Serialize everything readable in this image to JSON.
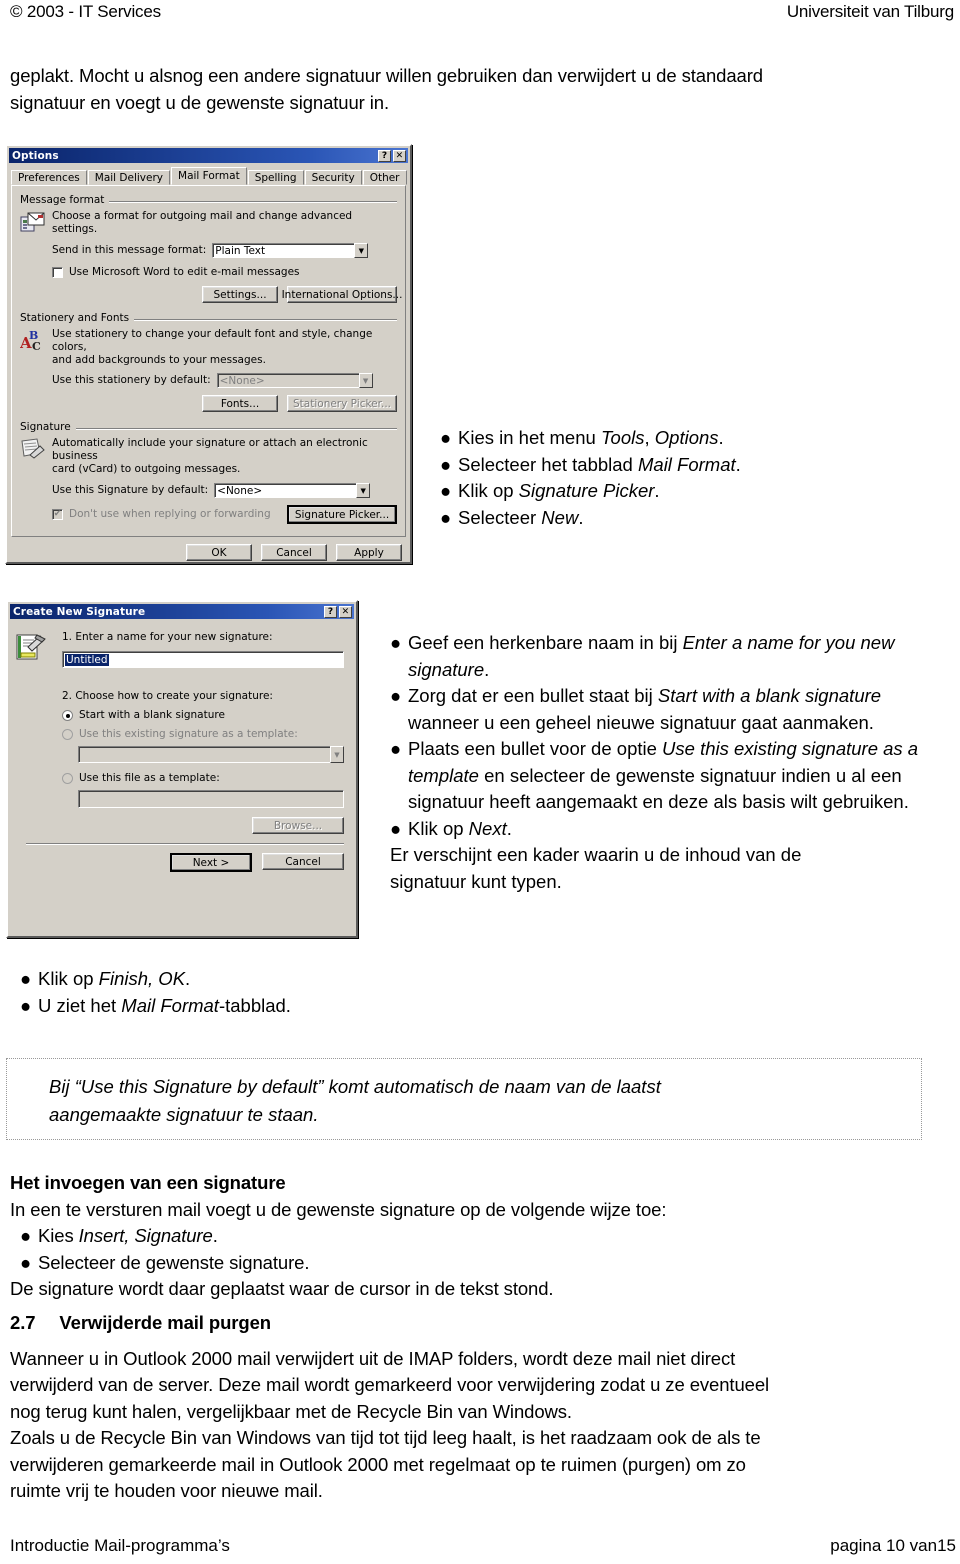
{
  "header": {
    "left": "© 2003 - IT Services",
    "right": "Universiteit van Tilburg"
  },
  "intro": {
    "line1": "geplakt. Mocht u alsnog een andere signatuur willen gebruiken dan verwijdert u de standaard",
    "line2": "signatuur en voegt u de gewenste signatuur in."
  },
  "options_dialog": {
    "title": "Options",
    "help_btn": "?",
    "close_btn": "✕",
    "tabs": [
      {
        "label": "Preferences",
        "active": false
      },
      {
        "label": "Mail Delivery",
        "active": false
      },
      {
        "label": "Mail Format",
        "active": true
      },
      {
        "label": "Spelling",
        "active": false
      },
      {
        "label": "Security",
        "active": false
      },
      {
        "label": "Other",
        "active": false
      }
    ],
    "message_format": {
      "group_label": "Message format",
      "description": "Choose a format for outgoing mail and change advanced settings.",
      "send_label": "Send in this message format:",
      "send_value": "Plain Text",
      "word_checkbox_label": "Use Microsoft Word to edit e-mail messages",
      "word_checkbox_checked": false,
      "settings_btn": "Settings...",
      "international_btn": "International Options..."
    },
    "stationery": {
      "group_label": "Stationery and Fonts",
      "description_line1": "Use stationery to change your default font and style, change colors,",
      "description_line2": "and add backgrounds to your messages.",
      "use_label": "Use this stationery by default:",
      "use_value": "<None>",
      "fonts_btn": "Fonts...",
      "picker_btn": "Stationery Picker..."
    },
    "signature": {
      "group_label": "Signature",
      "description_line1": "Automatically include your signature or attach an electronic business",
      "description_line2": "card (vCard) to outgoing messages.",
      "use_label": "Use this Signature by default:",
      "use_value": "<None>",
      "dont_use_label": "Don't use when replying or forwarding",
      "dont_use_checked": true,
      "picker_btn": "Signature Picker..."
    },
    "buttons": {
      "ok": "OK",
      "cancel": "Cancel",
      "apply": "Apply"
    }
  },
  "options_bullets": [
    {
      "pre": "Kies in het menu ",
      "em": "Tools",
      "mid": ", ",
      "em2": "Options",
      "post": "."
    },
    {
      "pre": "Selecteer het tabblad ",
      "em": "Mail Format",
      "post": "."
    },
    {
      "pre": "Klik op ",
      "em": "Signature Picker",
      "post": "."
    },
    {
      "pre": "Selecteer ",
      "em": "New",
      "post": "."
    }
  ],
  "signature_dialog": {
    "title": "Create New Signature",
    "help_btn": "?",
    "close_btn": "✕",
    "step1_label": "1. Enter a name for your new signature:",
    "name_value": "Untitled",
    "step2_label": "2. Choose how to create your signature:",
    "radio_blank": "Start with a blank signature",
    "radio_existing": "Use this existing signature as a template:",
    "radio_file": "Use this file as a template:",
    "existing_value": "",
    "file_value": "",
    "browse_btn": "Browse...",
    "next_btn": "Next >",
    "cancel_btn": "Cancel",
    "selected_option": "blank"
  },
  "signature_bullets_html": [
    "Geef een herkenbare naam in bij <i>Enter a name for you new signature</i>.",
    "Zorg dat er een bullet staat bij <i>Start with a blank signature</i> wanneer u een geheel nieuwe signatuur gaat aanmaken.",
    "Plaats een bullet voor de optie <i>Use this existing signature as a template</i> en selecteer de gewenste signatuur indien u al een signatuur heeft aangemaakt en deze als basis wilt gebruiken.",
    "Klik op <i>Next</i>."
  ],
  "signature_trailing": {
    "line1": "Er verschijnt een kader waarin u de inhoud van de",
    "line2": "signatuur kunt typen."
  },
  "finish_bullets_html": [
    "Klik op <i>Finish, OK</i>.",
    "U ziet het <i>Mail Format</i>-tabblad."
  ],
  "note": {
    "line1": "Bij “Use this Signature by default” komt automatisch de naam van de laatst",
    "line2": "aangemaakte signatuur te staan."
  },
  "insert_section": {
    "heading": "Het invoegen van een signature",
    "intro": "In een te versturen mail voegt u de gewenste signature op de volgende wijze toe:",
    "bullets_html": [
      "Kies <i>Insert, Signature</i>.",
      "Selecteer de gewenste signature."
    ],
    "trailing": "De signature wordt daar geplaatst waar de cursor in de tekst stond."
  },
  "purge_section": {
    "number": "2.7",
    "heading": "Verwijderde mail purgen",
    "paragraph_lines": [
      "Wanneer u in Outlook 2000 mail verwijdert uit de IMAP folders, wordt deze mail niet direct",
      "verwijderd van de server. Deze mail wordt gemarkeerd voor verwijdering zodat u ze eventueel",
      "nog terug kunt halen, vergelijkbaar met de Recycle Bin van Windows.",
      "Zoals u de Recycle Bin van Windows van tijd tot tijd leeg haalt, is het raadzaam ook de als te",
      "verwijderen gemarkeerde mail in Outlook 2000 met regelmaat op te ruimen (purgen) om zo",
      "ruimte vrij te houden voor nieuwe mail."
    ]
  },
  "footer": {
    "left": "Introductie Mail-programma’s",
    "right": "pagina 10 van15"
  },
  "colors": {
    "titlebar_start": "#0a246a",
    "dialog_face": "#d4d0c8",
    "text": "#000000"
  }
}
